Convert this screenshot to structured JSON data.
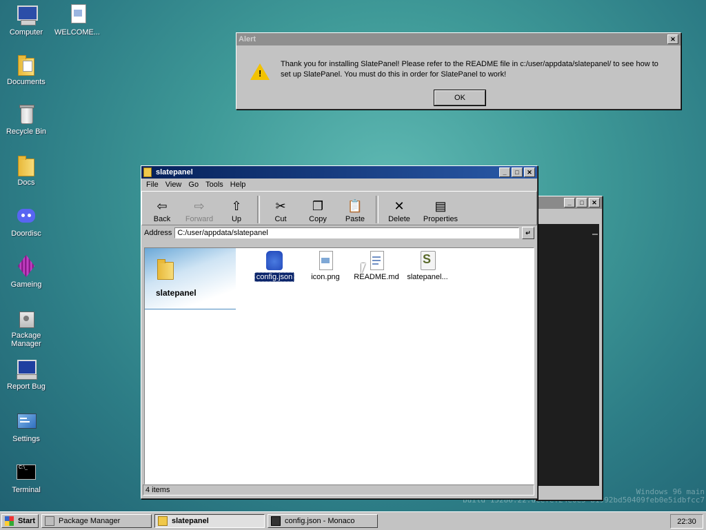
{
  "desktop": {
    "icons": [
      {
        "label": "Computer"
      },
      {
        "label": "WELCOME..."
      },
      {
        "label": "Documents"
      },
      {
        "label": "Recycle Bin"
      },
      {
        "label": "Docs"
      },
      {
        "label": "Doordisc"
      },
      {
        "label": "Gameing"
      },
      {
        "label": "Package Manager"
      },
      {
        "label": "Report Bug"
      },
      {
        "label": "Settings"
      },
      {
        "label": "Terminal"
      }
    ],
    "watermark": {
      "line1": "Windows 96 main",
      "line2": "build 15286.22.ucefe.24e0e5-b1992bd50409feb0e5idbfcc7"
    }
  },
  "alert": {
    "title": "Alert",
    "message": "Thank you for installing SlatePanel! Please refer to the README file in c:/user/appdata/slatepanel/ to see how to set up SlatePanel. You must do this in order for SlatePanel to work!",
    "ok_label": "OK",
    "close_glyph": "✕"
  },
  "explorer": {
    "title": "slatepanel",
    "menu": [
      "File",
      "View",
      "Go",
      "Tools",
      "Help"
    ],
    "toolbar": {
      "back": "Back",
      "forward": "Forward",
      "up": "Up",
      "cut": "Cut",
      "copy": "Copy",
      "paste": "Paste",
      "delete": "Delete",
      "properties": "Properties"
    },
    "address_label": "Address",
    "address_value": "C:/user/appdata/slatepanel",
    "sidebar_title": "slatepanel",
    "files": [
      {
        "name": "config.json",
        "selected": true
      },
      {
        "name": "icon.png",
        "selected": false
      },
      {
        "name": "README.md",
        "selected": false
      },
      {
        "name": "slatepanel...",
        "selected": false
      }
    ],
    "status": "4 items"
  },
  "taskbar": {
    "start_label": "Start",
    "tasks": [
      {
        "label": "Package Manager"
      },
      {
        "label": "slatepanel"
      },
      {
        "label": "config.json - Monaco"
      }
    ],
    "clock": "22:30"
  },
  "colors": {
    "title_active": "#06215a",
    "selection": "#0a246a",
    "desktop": "#3f9a98"
  }
}
